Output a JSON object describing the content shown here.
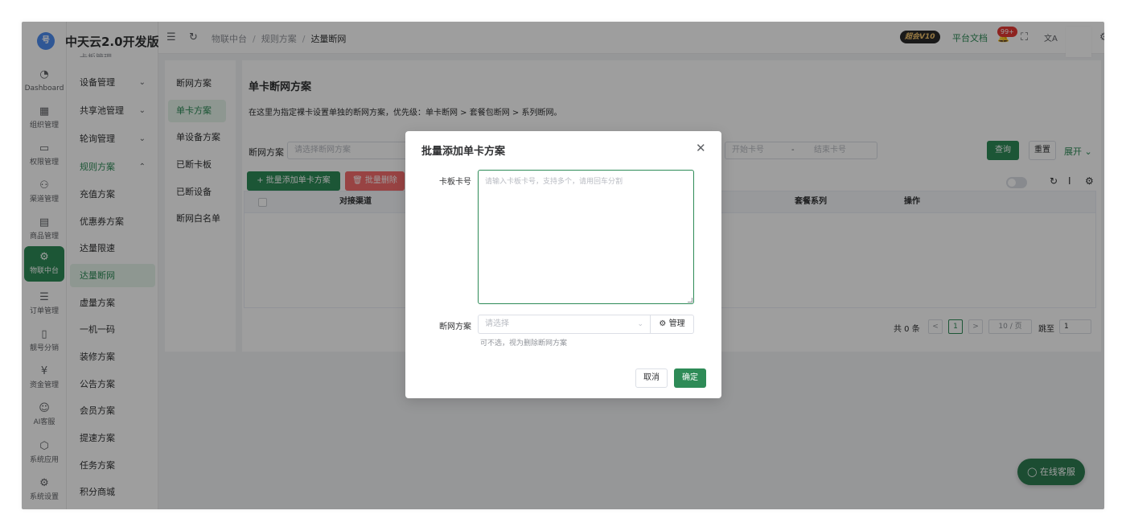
{
  "app": {
    "brand": "中天云2.0开发版",
    "logo_glyph": "号"
  },
  "rail": [
    {
      "label": "Dashboard",
      "glyph": "◔",
      "icon": "dashboard-icon"
    },
    {
      "label": "组织管理",
      "glyph": "▦",
      "icon": "org-icon"
    },
    {
      "label": "权限管理",
      "glyph": "▭",
      "icon": "permission-icon"
    },
    {
      "label": "渠道管理",
      "glyph": "⚇",
      "icon": "channel-icon"
    },
    {
      "label": "商品管理",
      "glyph": "▤",
      "icon": "goods-icon"
    },
    {
      "label": "物联中台",
      "glyph": "⚙",
      "icon": "iot-icon"
    },
    {
      "label": "订单管理",
      "glyph": "☰",
      "icon": "order-icon"
    },
    {
      "label": "靓号分销",
      "glyph": "▯",
      "icon": "number-icon"
    },
    {
      "label": "资金管理",
      "glyph": "¥",
      "icon": "fund-icon"
    },
    {
      "label": "AI客服",
      "glyph": "☺",
      "icon": "ai-service-icon"
    },
    {
      "label": "系统应用",
      "glyph": "⬡",
      "icon": "system-app-icon"
    },
    {
      "label": "系统设置",
      "glyph": "⚙",
      "icon": "settings-icon"
    }
  ],
  "submenu": {
    "cut_top": "卡板管理",
    "items": [
      {
        "label": "设备管理",
        "chev": "⌄"
      },
      {
        "label": "共享池管理",
        "chev": "⌄"
      },
      {
        "label": "轮询管理",
        "chev": "⌄"
      },
      {
        "label": "规则方案",
        "chev": "⌃"
      },
      {
        "label": "充值方案",
        "chev": ""
      },
      {
        "label": "优惠券方案",
        "chev": ""
      },
      {
        "label": "达量限速",
        "chev": ""
      },
      {
        "label": "达量断网",
        "chev": ""
      },
      {
        "label": "虚量方案",
        "chev": ""
      },
      {
        "label": "一机一码",
        "chev": ""
      },
      {
        "label": "装修方案",
        "chev": ""
      },
      {
        "label": "公告方案",
        "chev": ""
      },
      {
        "label": "会员方案",
        "chev": ""
      },
      {
        "label": "提速方案",
        "chev": ""
      },
      {
        "label": "任务方案",
        "chev": ""
      },
      {
        "label": "积分商城",
        "chev": ""
      }
    ]
  },
  "header": {
    "collapse_glyph": "☰",
    "refresh_glyph": "↻",
    "breadcrumb": [
      "物联中台",
      "规则方案",
      "达量断网"
    ],
    "separator": "/",
    "vip": "超会V10",
    "docs": "平台文档",
    "badge": "99+",
    "bell_glyph": "🔔",
    "fullscreen_glyph": "⛶",
    "translate_glyph": "文A",
    "settings_glyph": "⚙"
  },
  "leftnav": [
    "断网方案",
    "单卡方案",
    "单设备方案",
    "已断卡板",
    "已断设备",
    "断网白名单"
  ],
  "panel": {
    "title": "单卡断网方案",
    "desc": "在这里为指定裸卡设置单独的断网方案，优先级：单卡断网 > 套餐包断网 > 系列断网。",
    "filter_label": "断网方案",
    "filter_placeholder": "请选择断网方案",
    "start_placeholder": "开始卡号",
    "range_sep": "-",
    "end_placeholder": "结束卡号",
    "query": "查询",
    "reset": "重置",
    "expand": "展开",
    "expand_glyph": "⌄",
    "batch_add": "+ 批量添加单卡方案",
    "batch_delete": "🗑 批量删除",
    "tool_refresh": "↻",
    "tool_density": "I",
    "tool_settings": "⚙",
    "columns": [
      "对接渠道",
      "套餐系列",
      "操作"
    ],
    "pagination": {
      "total": "共 0 条",
      "prev": "<",
      "page": "1",
      "next": ">",
      "size": "10 / 页",
      "jump_label": "跳至",
      "jump_value": "1"
    }
  },
  "modal": {
    "title": "批量添加单卡方案",
    "close_glyph": "✕",
    "card_label": "卡板卡号",
    "card_placeholder": "请输入卡板卡号，支持多个，请用回车分割",
    "plan_label": "断网方案",
    "plan_placeholder": "请选择",
    "manage_label": "⚙ 管理",
    "hint": "可不选，视为删除断网方案",
    "cancel": "取消",
    "confirm": "确定"
  },
  "service": {
    "label": "在线客服",
    "glyph": "◯"
  },
  "colors": {
    "primary": "#2e8b57",
    "danger": "#f56c6c",
    "badge": "#e53935"
  }
}
